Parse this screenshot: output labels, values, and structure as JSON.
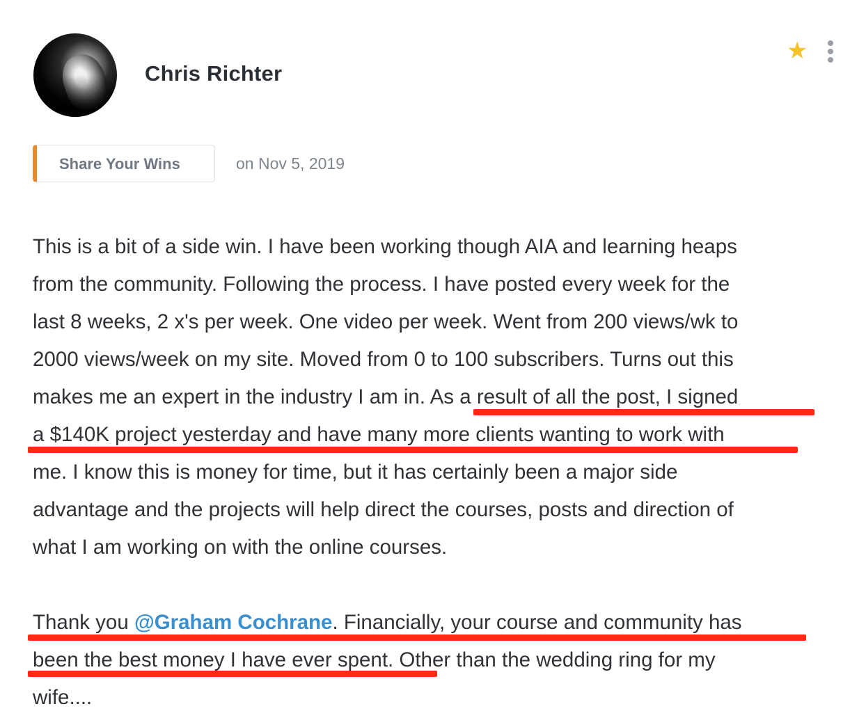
{
  "post": {
    "author": "Chris Richter",
    "category": "Share Your Wins",
    "date": "on Nov 5, 2019",
    "icons": {
      "favorite": "star-icon",
      "menu": "more-vertical-icon"
    },
    "accent_color": "#e8892b",
    "star_color": "#f6c12b",
    "mention_color": "#3a8fd0",
    "highlight_color": "#ff2a14"
  },
  "body": {
    "p1": {
      "l1": "This is a bit of a side win. I have been working though AIA and learning heaps",
      "l2": "from the community. Following the process. I have posted every week for the",
      "l3": "last 8 weeks, 2 x's per week. One video per week. Went from 200 views/wk to",
      "l4": "2000 views/week on my site. Moved from 0 to 100 subscribers. Turns out this",
      "l5": "makes me an expert in the industry I am in.  As a result of all the post, I signed",
      "l6": "a $140K project yesterday and have many more clients wanting to work with",
      "l7": "me. I know this is money for time, but it has certainly been a major side",
      "l8": "advantage and the projects will help direct the courses, posts and direction of",
      "l9": "what I am working on with the online courses."
    },
    "p2": {
      "prefix": "Thank you ",
      "mention": "@Graham Cochrane",
      "l1_rest": ". Financially, your course and community has",
      "l2": "been the best money I have ever spent. Other than the wedding ring for my",
      "l3": "wife...."
    }
  }
}
